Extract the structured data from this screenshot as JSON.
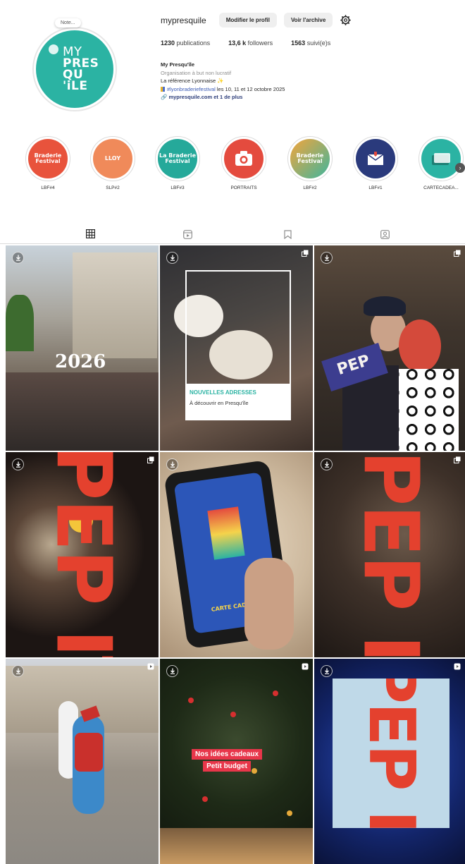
{
  "profile": {
    "username": "mypresquile",
    "edit_button": "Modifier le profil",
    "archive_button": "Voir l'archive",
    "note": "Note...",
    "avatar_lines": [
      "MY",
      "PRES",
      "QU",
      "'iLE"
    ]
  },
  "stats": {
    "posts_value": "1230",
    "posts_label": "publications",
    "followers_value": "13,6 k",
    "followers_label": "followers",
    "following_value": "1563",
    "following_label": "suivi(e)s"
  },
  "bio": {
    "name": "My Presqu'île",
    "category": "Organisation à but non lucratif",
    "line1": "La référence Lyonnaise ✨",
    "hashtag": "#lyonbraderiefestival",
    "line2_rest": " les 10, 11 et 12 octobre 2025",
    "link": "mypresquile.com et 1 de plus"
  },
  "highlights": [
    {
      "label": "LBF#4",
      "text": "Braderie Festival",
      "color": "#e8533c"
    },
    {
      "label": "SLP#2",
      "text": "LLOY",
      "color": "#f08a5a"
    },
    {
      "label": "LBF#3",
      "text": "La Braderie Festival",
      "color": "#25a99a"
    },
    {
      "label": "PORTRAITS",
      "text": "",
      "color": "#e44b3e"
    },
    {
      "label": "LBF#2",
      "text": "Braderie Festival",
      "color": "#3fb59c"
    },
    {
      "label": "LBF#1",
      "text": "",
      "color": "#2a3a7c"
    },
    {
      "label": "CARTECADEA...",
      "text": "",
      "color": "#2bb3a3"
    }
  ],
  "posts": [
    {
      "overlay": "2026"
    },
    {
      "overlay_title": "NOUVELLES ADRESSES",
      "overlay_sub": "À découvrir en Presqu'île"
    },
    {
      "overlay": "PEP"
    },
    {
      "overlay": "PEP ITES"
    },
    {
      "overlay": "CARTE CADEAU"
    },
    {
      "overlay": "PEP ITES"
    },
    {
      "overlay": ""
    },
    {
      "overlay_lines": [
        "Nos idées cadeaux",
        "Petit budget"
      ]
    },
    {
      "overlay": "PEP ITES"
    }
  ],
  "colors": {
    "brand_teal": "#2bb3a3",
    "pepites_red": "#e4412e",
    "link_blue": "#3b5bb5"
  }
}
